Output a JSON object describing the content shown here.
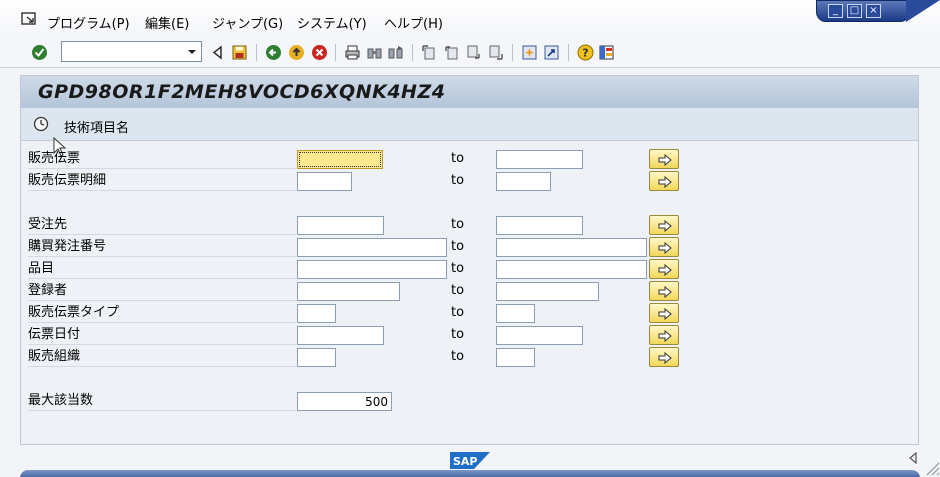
{
  "menu": {
    "items": [
      {
        "id": "program",
        "label": "プログラム(P)"
      },
      {
        "id": "edit",
        "label": "編集(E)"
      },
      {
        "id": "goto",
        "label": "ジャンプ(G)"
      },
      {
        "id": "system",
        "label": "システム(Y)"
      },
      {
        "id": "help",
        "label": "ヘルプ(H)"
      }
    ]
  },
  "toolbar": {
    "command_value": "",
    "icons": [
      "enter-icon",
      "command-dropdown-icon",
      "back-triangle-icon",
      "save-icon",
      "back-icon",
      "exit-icon",
      "cancel-icon",
      "print-icon",
      "find-icon",
      "find-next-icon",
      "first-page-icon",
      "previous-page-icon",
      "next-page-icon",
      "last-page-icon",
      "create-session-icon",
      "create-shortcut-icon",
      "help-icon",
      "layout-menu-icon"
    ]
  },
  "screen": {
    "title": "GPD98OR1F2MEH8VOCD6XQNK4HZ4",
    "app_toolbar_label": "技術項目名",
    "to_label": "to"
  },
  "fields": [
    {
      "id": "sales-document",
      "label": "販売伝票",
      "from": "",
      "to": ""
    },
    {
      "id": "sales-document-item",
      "label": "販売伝票明細",
      "from": "",
      "to": ""
    },
    {
      "id": "sold-to-party",
      "label": "受注先",
      "from": "",
      "to": ""
    },
    {
      "id": "purchase-order-number",
      "label": "購買発注番号",
      "from": "",
      "to": ""
    },
    {
      "id": "material",
      "label": "品目",
      "from": "",
      "to": ""
    },
    {
      "id": "created-by",
      "label": "登録者",
      "from": "",
      "to": ""
    },
    {
      "id": "sales-document-type",
      "label": "販売伝票タイプ",
      "from": "",
      "to": ""
    },
    {
      "id": "document-date",
      "label": "伝票日付",
      "from": "",
      "to": ""
    },
    {
      "id": "sales-organization",
      "label": "販売組織",
      "from": "",
      "to": ""
    }
  ],
  "max_hits": {
    "label": "最大該当数",
    "value": "500"
  },
  "footer": {
    "logo": "SAP"
  },
  "colors": {
    "active_field": "#ffe98c",
    "multi_select_button": "#f2d85a",
    "title_bar": "#b3c5d9",
    "window_controls": "#1b3a86"
  }
}
